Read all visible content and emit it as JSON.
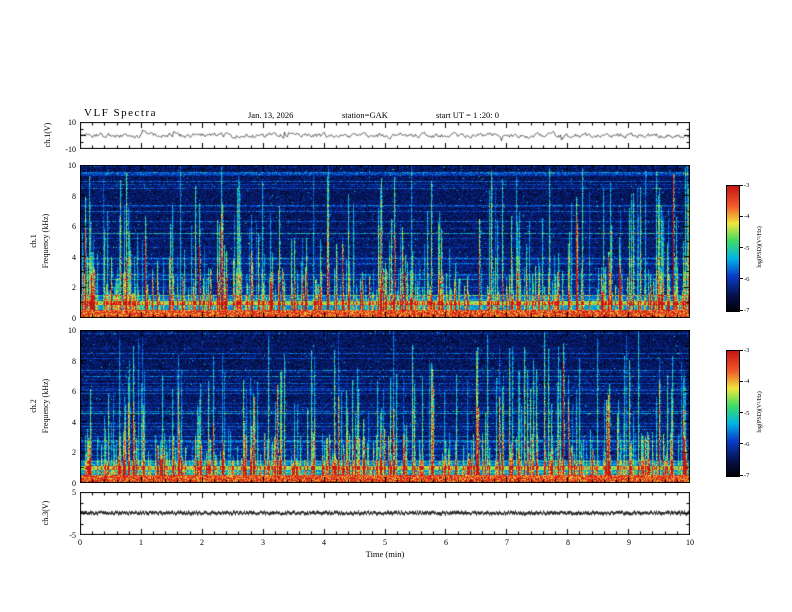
{
  "header": {
    "title": "VLF Spectra",
    "date": "Jan. 13, 2026",
    "station": "station=GAK",
    "start_ut": "start UT =  1 :20: 0"
  },
  "xaxis": {
    "label": "Time (min)",
    "ticks": [
      "0",
      "1",
      "2",
      "3",
      "4",
      "5",
      "6",
      "7",
      "8",
      "9",
      "10"
    ]
  },
  "panels": {
    "ch1_wave": {
      "ylabel": "ch.1(V)",
      "yticks": [
        "-10",
        "10"
      ]
    },
    "ch1_spec": {
      "ylabel_ch": "ch.1",
      "ylabel_freq": "Frequency (kHz)",
      "yticks": [
        "0",
        "2",
        "4",
        "6",
        "8",
        "10"
      ]
    },
    "ch2_spec": {
      "ylabel_ch": "ch.2",
      "ylabel_freq": "Frequency (kHz)",
      "yticks": [
        "0",
        "2",
        "4",
        "6",
        "8",
        "10"
      ]
    },
    "ch3_wave": {
      "ylabel": "ch.3(V)",
      "yticks": [
        "-5",
        "5"
      ]
    }
  },
  "colorbar": {
    "label": "log(PSD)(V²/Hz)",
    "ticks": [
      "-3",
      "-4",
      "-5",
      "-6",
      "-7"
    ]
  },
  "chart_data": [
    {
      "type": "line",
      "name": "ch.1 time series",
      "ylabel": "ch.1(V)",
      "ylim": [
        -10,
        10
      ],
      "xlim_min": [
        0,
        10
      ],
      "description": "Broadband noisy voltage trace fluctuating a few volts around 0 V for the full 10 minutes, with occasional larger spikes."
    },
    {
      "type": "heatmap",
      "name": "ch.1 spectrogram",
      "ylabel": "Frequency (kHz)",
      "ylim": [
        0,
        10
      ],
      "xlim_min": [
        0,
        10
      ],
      "value_label": "log(PSD)(V²/Hz)",
      "value_range": [
        -7,
        -3
      ],
      "features": "Dark blue/black background noise; intense yellow-red band below ~1 kHz; persistent horizontal striping between ~1 and 3 kHz; hundreds of vertical broadband sferic streaks (green/cyan/yellow) of varying height, some reaching 10 kHz.",
      "colormap": [
        {
          "t": 0.0,
          "c": "#000006"
        },
        {
          "t": 0.12,
          "c": "#04104a"
        },
        {
          "t": 0.28,
          "c": "#0a3cc8"
        },
        {
          "t": 0.42,
          "c": "#00b4e6"
        },
        {
          "t": 0.56,
          "c": "#3cdc64"
        },
        {
          "t": 0.7,
          "c": "#f0e63c"
        },
        {
          "t": 0.84,
          "c": "#f05a28"
        },
        {
          "t": 1.0,
          "c": "#c81414"
        }
      ]
    },
    {
      "type": "heatmap",
      "name": "ch.2 spectrogram",
      "ylabel": "Frequency (kHz)",
      "ylim": [
        0,
        10
      ],
      "xlim_min": [
        0,
        10
      ],
      "value_label": "log(PSD)(V²/Hz)",
      "value_range": [
        -7,
        -3
      ],
      "features": "Very similar to ch.1 spectrogram: bright low-frequency band below ~1 kHz, horizontal banding near 1-3 kHz, dense vertical sferic streaks over dark blue background.",
      "colormap": [
        {
          "t": 0.0,
          "c": "#000006"
        },
        {
          "t": 0.12,
          "c": "#04104a"
        },
        {
          "t": 0.28,
          "c": "#0a3cc8"
        },
        {
          "t": 0.42,
          "c": "#00b4e6"
        },
        {
          "t": 0.56,
          "c": "#3cdc64"
        },
        {
          "t": 0.7,
          "c": "#f0e63c"
        },
        {
          "t": 0.84,
          "c": "#f05a28"
        },
        {
          "t": 1.0,
          "c": "#c81414"
        }
      ]
    },
    {
      "type": "line",
      "name": "ch.3 time series",
      "ylabel": "ch.3(V)",
      "ylim": [
        -5,
        5
      ],
      "xlim_min": [
        0,
        10
      ],
      "description": "Essentially flat dense dark trace at 0 V for the whole interval."
    }
  ]
}
